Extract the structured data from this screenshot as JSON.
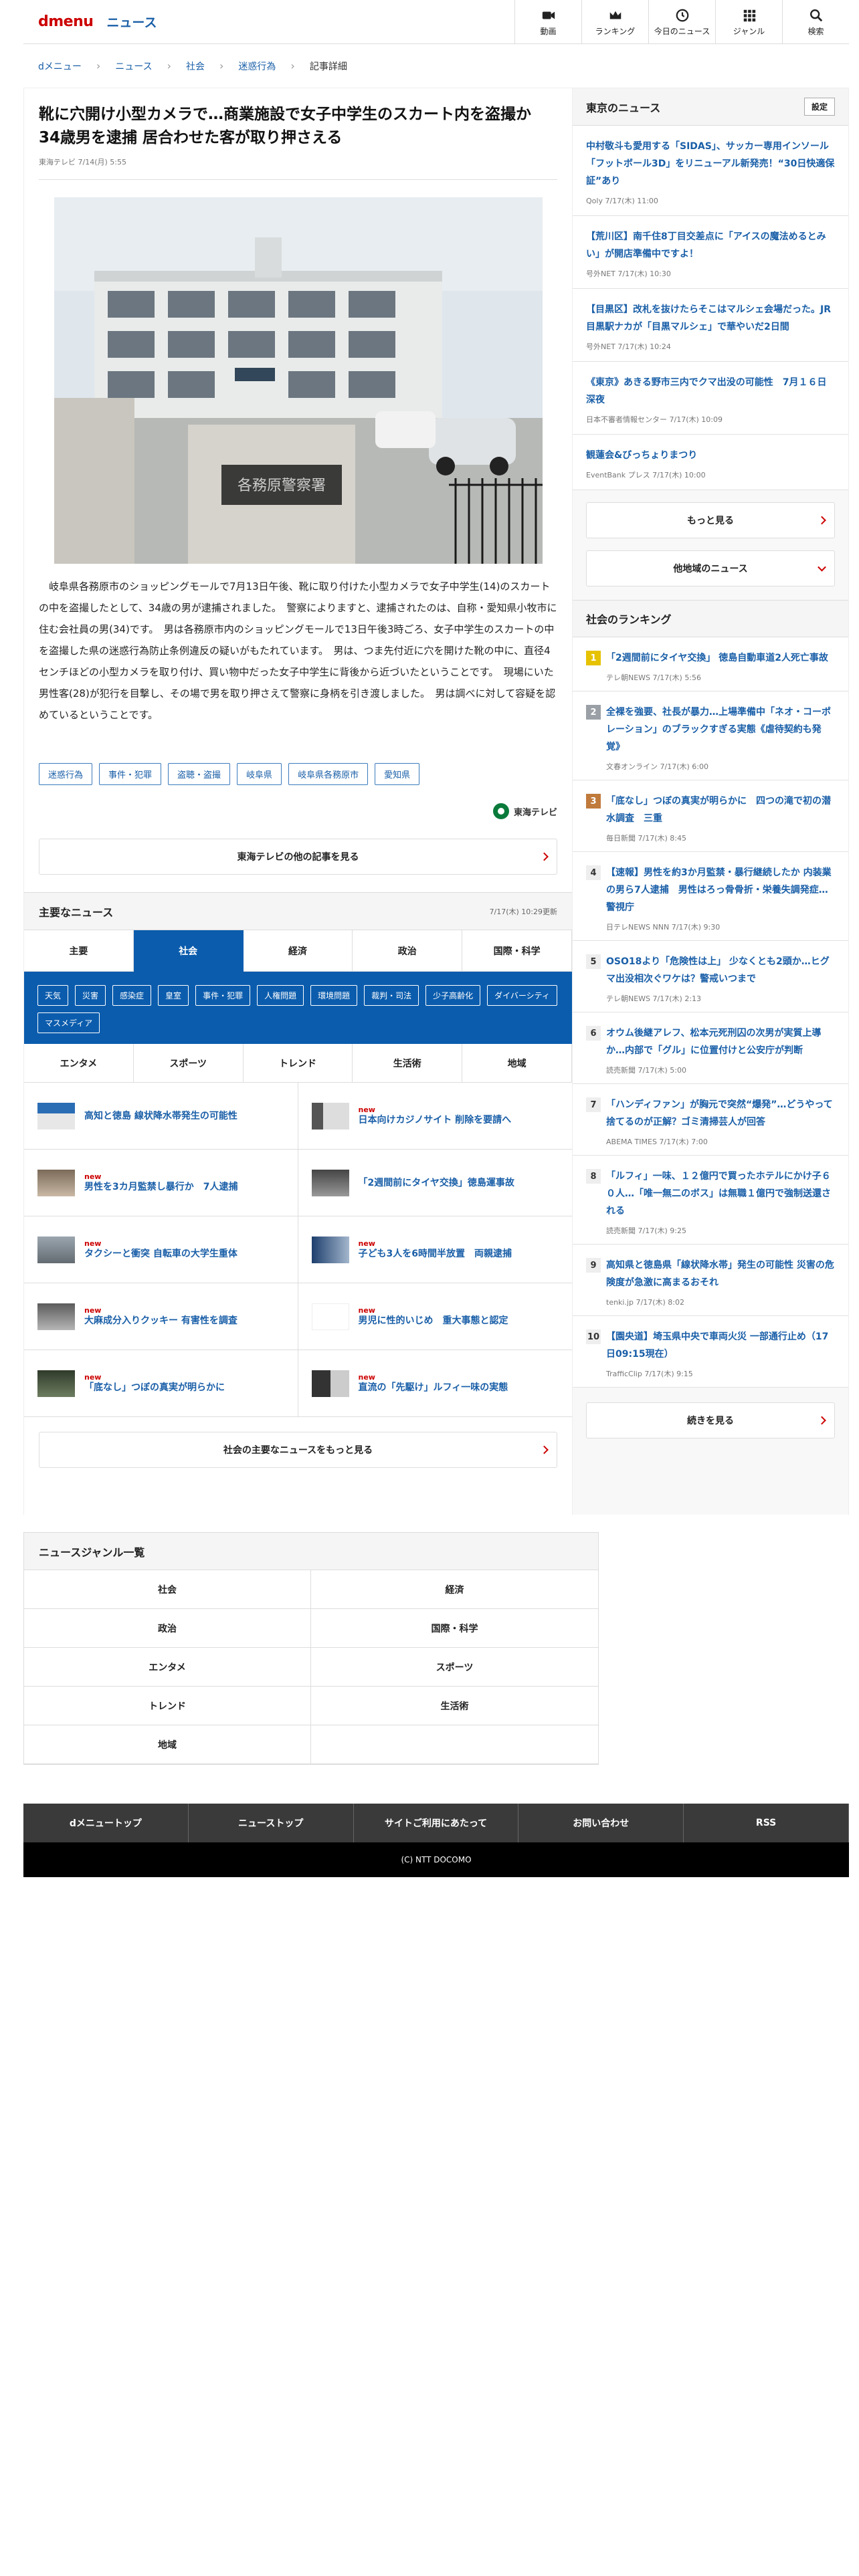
{
  "header": {
    "logo": "dmenu",
    "site_title": "ニュース",
    "nav": [
      {
        "label": "動画",
        "icon": "video-icon"
      },
      {
        "label": "ランキング",
        "icon": "crown-icon"
      },
      {
        "label": "今日のニュース",
        "icon": "clock-icon"
      },
      {
        "label": "ジャンル",
        "icon": "grid-icon"
      },
      {
        "label": "検索",
        "icon": "search-icon"
      }
    ]
  },
  "breadcrumb": {
    "items": [
      "dメニュー",
      "ニュース",
      "社会",
      "迷惑行為"
    ],
    "current": "記事詳細"
  },
  "article": {
    "title": "靴に穴開け小型カメラで…商業施設で女子中学生のスカート内を盗撮か 34歳男を逮捕 居合わせた客が取り押さえる",
    "source_date": "東海テレビ 7/14(月) 5:55",
    "photo_sign": "各務原警察署",
    "body": "岐阜県各務原市のショッピングモールで7月13日午後、靴に取り付けた小型カメラで女子中学生(14)のスカートの中を盗撮したとして、34歳の男が逮捕されました。　警察によりますと、逮捕されたのは、自称・愛知県小牧市に住む会社員の男(34)です。　男は各務原市内のショッピングモールで13日午後3時ごろ、女子中学生のスカートの中を盗撮した県の迷惑行為防止条例違反の疑いがもたれています。　男は、つま先付近に穴を開けた靴の中に、直径4センチほどの小型カメラを取り付け、買い物中だった女子中学生に背後から近づいたということです。　現場にいた男性客(28)が犯行を目撃し、その場で男を取り押さえて警察に身柄を引き渡しました。　男は調べに対して容疑を認めているということです。",
    "tags": [
      "迷惑行為",
      "事件・犯罪",
      "盗聴・盗撮",
      "岐阜県",
      "岐阜県各務原市",
      "愛知県"
    ],
    "source_logo": "東海テレビ",
    "more_label": "東海テレビの他の記事を見る"
  },
  "major": {
    "title": "主要なニュース",
    "updated": "7/17(木) 10:29更新",
    "tabs": [
      "主要",
      "社会",
      "経済",
      "政治",
      "国際・科学"
    ],
    "active_tab": "社会",
    "subtags": [
      "天気",
      "災害",
      "感染症",
      "皇室",
      "事件・犯罪",
      "人権問題",
      "環境問題",
      "裁判・司法",
      "少子高齢化",
      "ダイバーシティ",
      "マスメディア"
    ],
    "tabs2": [
      "エンタメ",
      "スポーツ",
      "トレンド",
      "生活術",
      "地域"
    ],
    "items": [
      {
        "text": "高知と徳島 線状降水帯発生の可能性",
        "new": ""
      },
      {
        "text": "日本向けカジノサイト 削除を要請へ",
        "new": "new"
      },
      {
        "text": "男性を3カ月監禁し暴行か　7人逮捕",
        "new": "new"
      },
      {
        "text": "「2週間前にタイヤ交換」徳島運事故",
        "new": ""
      },
      {
        "text": "タクシーと衝突 自転車の大学生重体",
        "new": "new"
      },
      {
        "text": "子ども3人を6時間半放置　両親逮捕",
        "new": "new"
      },
      {
        "text": "大麻成分入りクッキー 有害性を調査",
        "new": "new"
      },
      {
        "text": "男児に性的いじめ　重大事態と認定",
        "new": "new"
      },
      {
        "text": "「底なし」つぼの真実が明らかに",
        "new": "new"
      },
      {
        "text": "直流の「先駆け」ルフィ一味の実態",
        "new": "new"
      }
    ],
    "more_label": "社会の主要なニュースをもっと見る"
  },
  "tokyo": {
    "title": "東京のニュース",
    "settings": "設定",
    "items": [
      {
        "title": "中村敬斗も愛用する「SIDAS」、サッカー専用インソール「フットボール3D」をリニューアル新発売！“30日快適保証”あり",
        "meta": "Qoly 7/17(木) 11:00"
      },
      {
        "title": "【荒川区】南千住8丁目交差点に「アイスの魔法めるとみい」が開店準備中ですよ！",
        "meta": "号外NET 7/17(木) 10:30"
      },
      {
        "title": "【目黒区】改札を抜けたらそこはマルシェ会場だった。JR目黒駅ナカが「目黒マルシェ」で華やいだ2日間",
        "meta": "号外NET 7/17(木) 10:24"
      },
      {
        "title": "《東京》あきる野市三内でクマ出没の可能性　7月１６日深夜",
        "meta": "日本不審者情報センター 7/17(木) 10:09"
      },
      {
        "title": "観蓮会&びっちょりまつり",
        "meta": "EventBank プレス 7/17(木) 10:00"
      }
    ],
    "more_label": "もっと見る",
    "other_label": "他地域のニュース"
  },
  "ranking": {
    "title": "社会のランキング",
    "items": [
      {
        "n": "1",
        "title": "「2週間前にタイヤ交換」 徳島自動車道2人死亡事故",
        "meta": "テレ朝NEWS 7/17(木) 5:56"
      },
      {
        "n": "2",
        "title": "全裸を強要、社長が暴力…上場準備中「ネオ・コーポレーション」のブラックすぎる実態《虐待契約も発覚》",
        "meta": "文春オンライン 7/17(木) 6:00"
      },
      {
        "n": "3",
        "title": "「底なし」つぼの真実が明らかに　四つの滝で初の潜水調査　三重",
        "meta": "毎日新聞 7/17(木) 8:45"
      },
      {
        "n": "4",
        "title": "【速報】男性を約3か月監禁・暴行継続したか 内装業の男ら7人逮捕　男性はろっ骨骨折・栄養失調発症…警視庁",
        "meta": "日テレNEWS NNN 7/17(木) 9:30"
      },
      {
        "n": "5",
        "title": "OSO18より「危険性は上」 少なくとも2頭か…ヒグマ出没相次ぐワケは？警戒いつまで",
        "meta": "テレ朝NEWS 7/17(木) 2:13"
      },
      {
        "n": "6",
        "title": "オウム後継アレフ、松本元死刑囚の次男が実質上導か…内部で「グル」に位置付けと公安庁が判断",
        "meta": "読売新聞 7/17(木) 5:00"
      },
      {
        "n": "7",
        "title": "「ハンディファン」が胸元で突然“爆発”…どうやって捨てるのが正解？ゴミ清掃芸人が回答",
        "meta": "ABEMA TIMES 7/17(木) 7:00"
      },
      {
        "n": "8",
        "title": "「ルフィ」一味、１２億円で買ったホテルにかけ子６０人…「唯一無二のボス」は無職１億円で強制送還される",
        "meta": "読売新聞 7/17(木) 9:25"
      },
      {
        "n": "9",
        "title": "高知県と徳島県「線状降水帯」発生の可能性 災害の危険度が急激に高まるおそれ",
        "meta": "tenki.jp 7/17(木) 8:02"
      },
      {
        "n": "10",
        "title": "【園央道】埼玉県中央で車両火災 一部通行止め（17日09:15現在）",
        "meta": "TrafficClip 7/17(木) 9:15"
      }
    ],
    "more_label": "続きを見る"
  },
  "genre": {
    "title": "ニュースジャンル一覧",
    "items": [
      "社会",
      "経済",
      "政治",
      "国際・科学",
      "エンタメ",
      "スポーツ",
      "トレンド",
      "生活術",
      "地域"
    ]
  },
  "footer": {
    "links": [
      "dメニュートップ",
      "ニューストップ",
      "サイトご利用にあたって",
      "お問い合わせ",
      "RSS"
    ],
    "copyright": "(C) NTT DOCOMO"
  },
  "colors": {
    "brand": "#cc0000",
    "link": "#1a5fa8",
    "tab_active": "#0b5cad"
  }
}
